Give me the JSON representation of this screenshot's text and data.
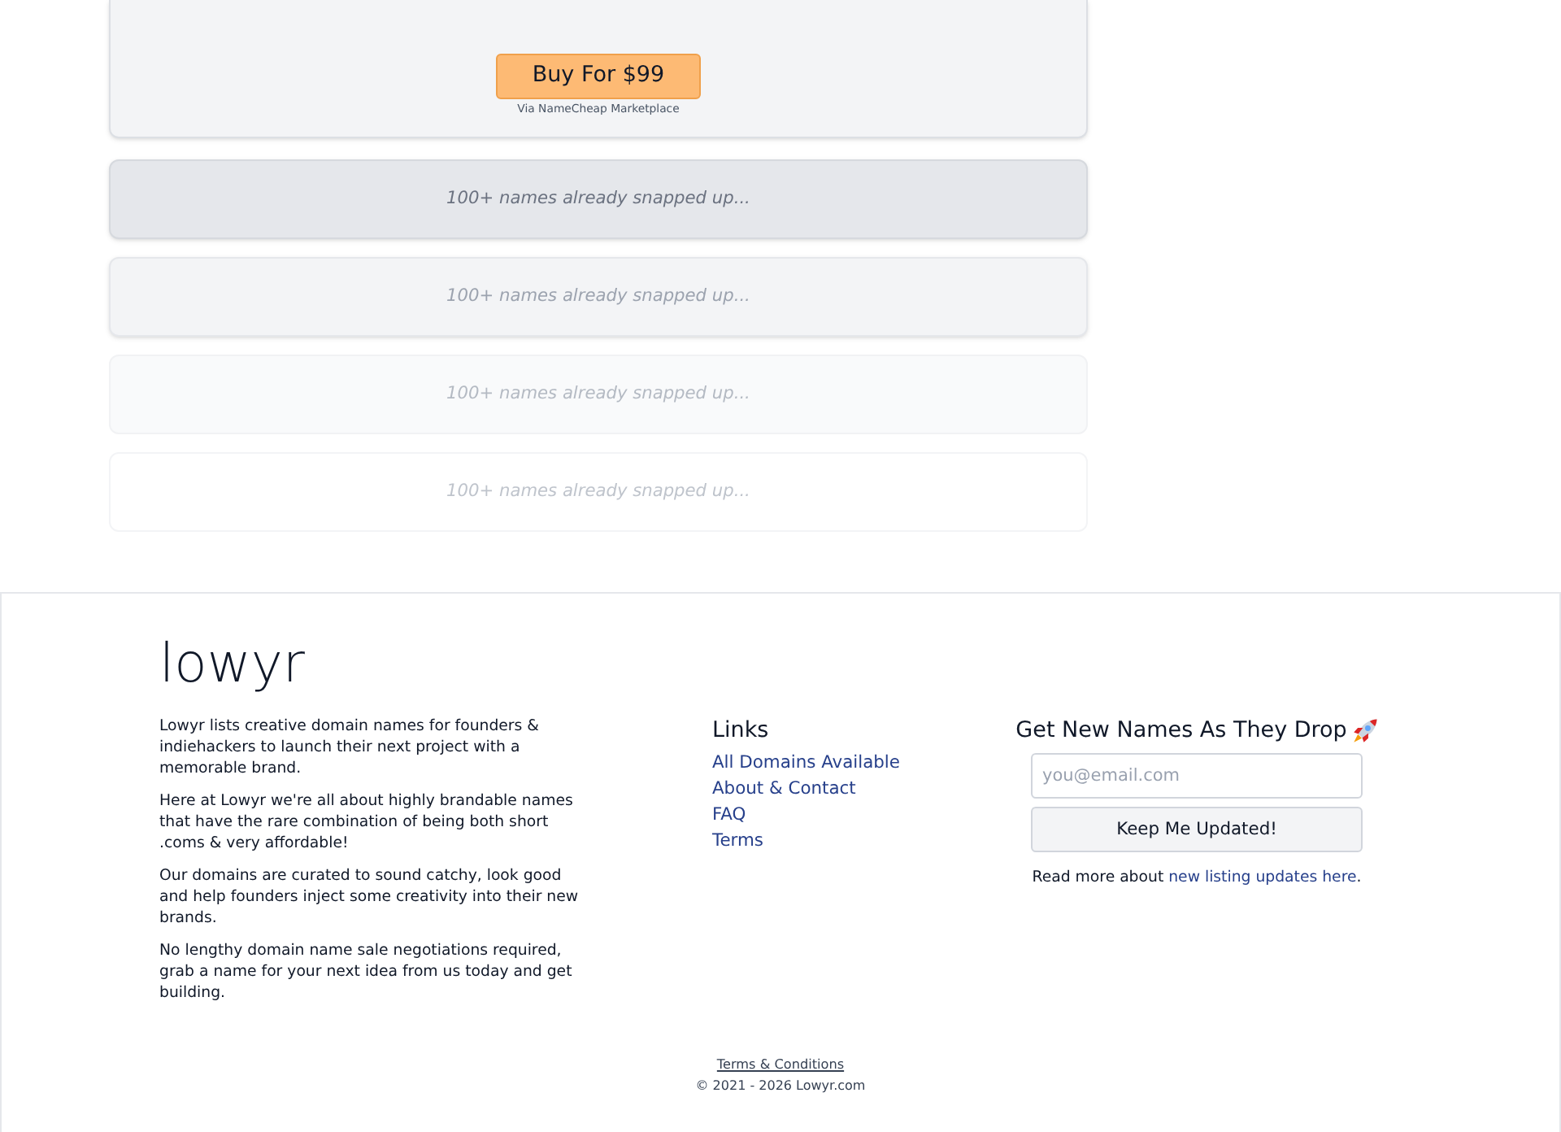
{
  "listing": {
    "buy_button": "Buy For $99",
    "via": "Via NameCheap Marketplace"
  },
  "teasers": [
    {
      "text": "100+ names already snapped up...",
      "kind": "strong"
    },
    {
      "text": "100+ names already snapped up...",
      "kind": "medium"
    },
    {
      "text": "100+ names already snapped up...",
      "kind": "faint"
    },
    {
      "text": "100+ names already snapped up...",
      "kind": "faintest"
    }
  ],
  "footer": {
    "logo": "lowyr",
    "about": [
      "Lowyr lists creative domain names for founders & indiehackers to launch their next project with a memorable brand.",
      "Here at Lowyr we're all about highly brandable names that have the rare combination of being both short .coms & very affordable!",
      "Our domains are curated to sound catchy, look good and help founders inject some creativity into their new brands.",
      "No lengthy domain name sale negotiations required, grab a name for your next idea from us today and get building."
    ],
    "links": {
      "heading": "Links",
      "items": [
        "All Domains Available",
        "About & Contact",
        "FAQ",
        "Terms"
      ]
    },
    "newsletter": {
      "heading": "Get New Names As They Drop",
      "placeholder": "you@email.com",
      "button": "Keep Me Updated!",
      "note": "Read more about",
      "note_link": "new listing updates here",
      "note_end": "."
    }
  },
  "bottom": {
    "terms": "Terms & Conditions",
    "copyright": "© 2021 - 2026 Lowyr.com"
  }
}
